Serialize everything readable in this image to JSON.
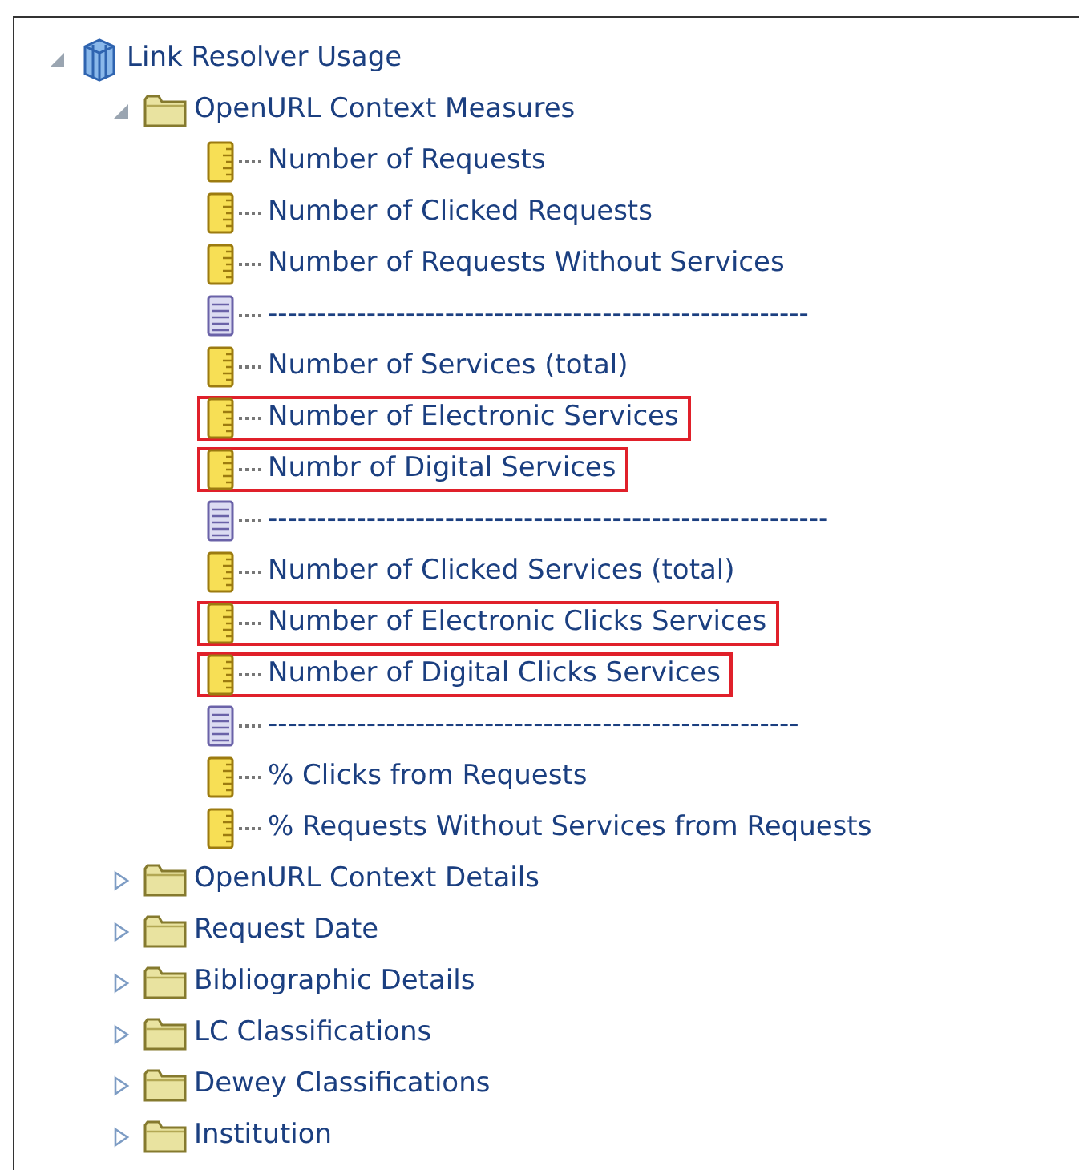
{
  "tree": [
    {
      "kind": "cube",
      "label": "Link Resolver Usage",
      "expanded": true,
      "children": [
        {
          "kind": "folder",
          "label": "OpenURL Context Measures",
          "expanded": true,
          "children": [
            {
              "kind": "measure",
              "label": "Number of Requests",
              "highlighted": false
            },
            {
              "kind": "measure",
              "label": "Number of Clicked Requests",
              "highlighted": false
            },
            {
              "kind": "measure",
              "label": "Number of Requests Without Services",
              "highlighted": false
            },
            {
              "kind": "separator",
              "label": "-------------------------------------------------------",
              "highlighted": false
            },
            {
              "kind": "measure",
              "label": "Number of Services (total)",
              "highlighted": false
            },
            {
              "kind": "measure",
              "label": "Number of Electronic Services",
              "highlighted": true
            },
            {
              "kind": "measure",
              "label": "Numbr of Digital Services",
              "highlighted": true
            },
            {
              "kind": "separator",
              "label": "---------------------------------------------------------",
              "highlighted": false
            },
            {
              "kind": "measure",
              "label": "Number of Clicked Services (total)",
              "highlighted": false
            },
            {
              "kind": "measure",
              "label": "Number of Electronic Clicks Services",
              "highlighted": true
            },
            {
              "kind": "measure",
              "label": "Number of Digital Clicks Services",
              "highlighted": true
            },
            {
              "kind": "separator",
              "label": "------------------------------------------------------",
              "highlighted": false
            },
            {
              "kind": "measure",
              "label": "% Clicks from Requests",
              "highlighted": false
            },
            {
              "kind": "measure",
              "label": "% Requests Without Services from Requests",
              "highlighted": false
            }
          ]
        },
        {
          "kind": "folder",
          "label": "OpenURL Context Details",
          "expanded": false
        },
        {
          "kind": "folder",
          "label": "Request Date",
          "expanded": false
        },
        {
          "kind": "folder",
          "label": "Bibliographic Details",
          "expanded": false
        },
        {
          "kind": "folder",
          "label": "LC Classifications",
          "expanded": false
        },
        {
          "kind": "folder",
          "label": "Dewey Classifications",
          "expanded": false
        },
        {
          "kind": "folder",
          "label": "Institution",
          "expanded": false
        }
      ]
    }
  ]
}
